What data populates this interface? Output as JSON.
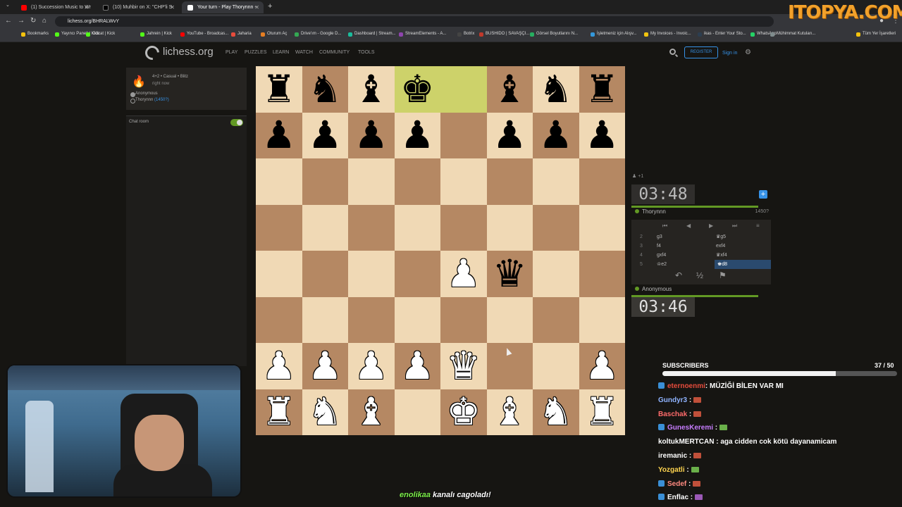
{
  "browser": {
    "tabs": [
      {
        "title": "(1) Succession Music to Wr",
        "color": "#ff0000"
      },
      {
        "title": "(10) Muhbir on X: \"CHP'li S",
        "color": "#111111"
      },
      {
        "title": "Your turn - Play Thorynnn -",
        "color": "#ffffff"
      }
    ],
    "url": "lichess.org/BHRALWvY",
    "bookmarks": [
      {
        "label": "Bookmarks",
        "color": "#f4c20d"
      },
      {
        "label": "Yayıncı Paneli | Kick",
        "color": "#53fc18"
      },
      {
        "label": "Gözat | Kick",
        "color": "#53fc18"
      },
      {
        "label": "Jahrein | Kick",
        "color": "#53fc18"
      },
      {
        "label": "YouTube - Broadcas...",
        "color": "#ff0000"
      },
      {
        "label": "Jaharia",
        "color": "#e74c3c"
      },
      {
        "label": "Oturum Aç",
        "color": "#e67e22"
      },
      {
        "label": "Drive'ım - Google D...",
        "color": "#34a853"
      },
      {
        "label": "Dashboard | Stream...",
        "color": "#1abc9c"
      },
      {
        "label": "StreamElements - A...",
        "color": "#8e44ad"
      },
      {
        "label": "Botrix",
        "color": "#444444"
      },
      {
        "label": "BUSHIDO | SAVAŞÇI...",
        "color": "#c0392b"
      },
      {
        "label": "Görsel Boyutlarını N...",
        "color": "#27ae60"
      },
      {
        "label": "İşletmeniz için Alışv...",
        "color": "#3498db"
      },
      {
        "label": "My Invoices - Invoic...",
        "color": "#f1c40f"
      },
      {
        "label": "ikas - Enter Your Sto...",
        "color": "#2c3e50"
      },
      {
        "label": "WhatsApp",
        "color": "#25d366"
      },
      {
        "label": "Mühimmat Kutuları...",
        "color": "#7f8c8d"
      },
      {
        "label": "Tüm Yer İşaretleri",
        "color": "#f4c20d"
      }
    ],
    "watermark": "ITOPYA.COM"
  },
  "lichess": {
    "logo": "lichess.org",
    "nav": [
      "PLAY",
      "PUZZLES",
      "LEARN",
      "WATCH",
      "COMMUNITY",
      "TOOLS"
    ],
    "register": "REGISTER",
    "sign_in": "Sign in"
  },
  "game_info": {
    "setup": "4+2 • Casual • Blitz",
    "time": "right now",
    "player1": "Anonymous",
    "player2": "Thorynnn",
    "player2_rating": "(1450?)"
  },
  "chat": {
    "title": "Chat room"
  },
  "board": {
    "rows": [
      [
        "br",
        "bn",
        "bb",
        "bk",
        "",
        "bb",
        "bn",
        "br"
      ],
      [
        "bp",
        "bp",
        "bp",
        "bp",
        "",
        "bp",
        "bp",
        "bp"
      ],
      [
        "",
        "",
        "",
        "",
        "",
        "",
        "",
        ""
      ],
      [
        "",
        "",
        "",
        "",
        "",
        "",
        "",
        ""
      ],
      [
        "",
        "",
        "",
        "",
        "wp",
        "bq",
        "",
        ""
      ],
      [
        "",
        "",
        "",
        "",
        "",
        "",
        "",
        ""
      ],
      [
        "wp",
        "wp",
        "wp",
        "wp",
        "wq",
        "",
        "",
        "wp"
      ],
      [
        "wr",
        "wn",
        "wb",
        "",
        "wk",
        "wb",
        "wn",
        "wr"
      ]
    ],
    "highlight": [
      [
        0,
        3
      ],
      [
        0,
        4
      ]
    ]
  },
  "clocks": {
    "opponent": "03:48",
    "self": "03:46",
    "opponent_name": "Thorynnn",
    "opponent_rating": "1450?",
    "self_name": "Anonymous",
    "moved_indicator": "+1"
  },
  "moves": [
    {
      "n": "2",
      "w": "g3",
      "b": "♛g5"
    },
    {
      "n": "3",
      "w": "f4",
      "b": "exf4"
    },
    {
      "n": "4",
      "w": "gxf4",
      "b": "♛xf4"
    },
    {
      "n": "5",
      "w": "♔e2",
      "b": "♚d8"
    }
  ],
  "stream": {
    "subscribers_label": "SUBSCRIBERS",
    "subscribers_count": "37 / 50",
    "subscribers_fraction": 0.74,
    "chat": [
      {
        "user": "eternoenmi",
        "color": "#e74c3c",
        "text": ": MÜZİĞİ BİLEN VAR MI",
        "badge": true,
        "emote": ""
      },
      {
        "user": "Gundyr3",
        "color": "#8fb3ff",
        "text": " :",
        "badge": false,
        "emote": "r"
      },
      {
        "user": "Baschak",
        "color": "#ff6b6b",
        "text": " :",
        "badge": false,
        "emote": "r"
      },
      {
        "user": "GunesKeremi",
        "color": "#c77dff",
        "text": " :",
        "badge": true,
        "emote": "g"
      },
      {
        "user": "koltukMERTCAN",
        "color": "#ffffff",
        "text": " : aga cidden cok kötü dayanamicam",
        "badge": false,
        "emote": ""
      },
      {
        "user": "iremanic",
        "color": "#ffffff",
        "text": " :",
        "badge": false,
        "emote": "r"
      },
      {
        "user": "Yozgatli",
        "color": "#ffd54f",
        "text": " :",
        "badge": false,
        "emote": "g"
      },
      {
        "user": "Sedef",
        "color": "#ff8a80",
        "text": " :",
        "badge": true,
        "emote": "r"
      },
      {
        "user": "Enflac",
        "color": "#ffffff",
        "text": " :",
        "badge": true,
        "emote": "p"
      }
    ],
    "alert_name": "enolikaa",
    "alert_text": " kanalı cagoladı!"
  }
}
